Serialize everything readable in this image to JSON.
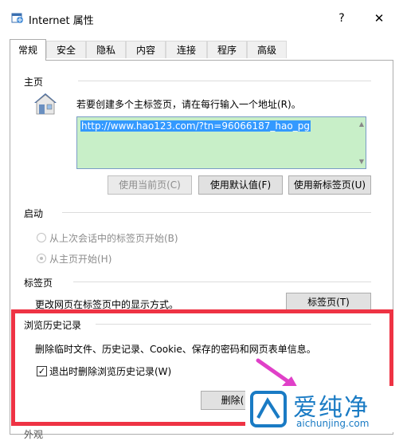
{
  "window": {
    "title": "Internet 属性",
    "help_label": "?",
    "close_label": "✕"
  },
  "tabs": [
    {
      "label": "常规",
      "active": true
    },
    {
      "label": "安全"
    },
    {
      "label": "隐私"
    },
    {
      "label": "内容"
    },
    {
      "label": "连接"
    },
    {
      "label": "程序"
    },
    {
      "label": "高级"
    }
  ],
  "home": {
    "title": "主页",
    "description": "若要创建多个主标签页，请在每行输入一个地址(R)。",
    "url": "http://www.hao123.com/?tn=96066187_hao_pg",
    "buttons": {
      "use_current": "使用当前页(C)",
      "use_default": "使用默认值(F)",
      "use_new_tab": "使用新标签页(U)"
    },
    "icon": "house-icon"
  },
  "startup": {
    "title": "启动",
    "option_last_session": "从上次会话中的标签页开始(B)",
    "option_home": "从主页开始(H)",
    "selected": "option_home"
  },
  "tabs_section": {
    "title": "标签页",
    "description": "更改网页在标签页中的显示方式。",
    "button": "标签页(T)"
  },
  "history": {
    "title": "浏览历史记录",
    "description": "删除临时文件、历史记录、Cookie、保存的密码和网页表单信息。",
    "checkbox_label": "退出时删除浏览历史记录(W)",
    "checkbox_checked": true,
    "delete_button": "删除("
  },
  "bottom_fragment": "外观",
  "watermark": {
    "brand": "爱纯净",
    "url": "aichunjing.com"
  },
  "colors": {
    "highlight_box": "#ee3344",
    "url_bg": "#c8efc8",
    "selection": "#3399ff",
    "watermark": "#1a7bc4",
    "arrow": "#e040c8"
  }
}
